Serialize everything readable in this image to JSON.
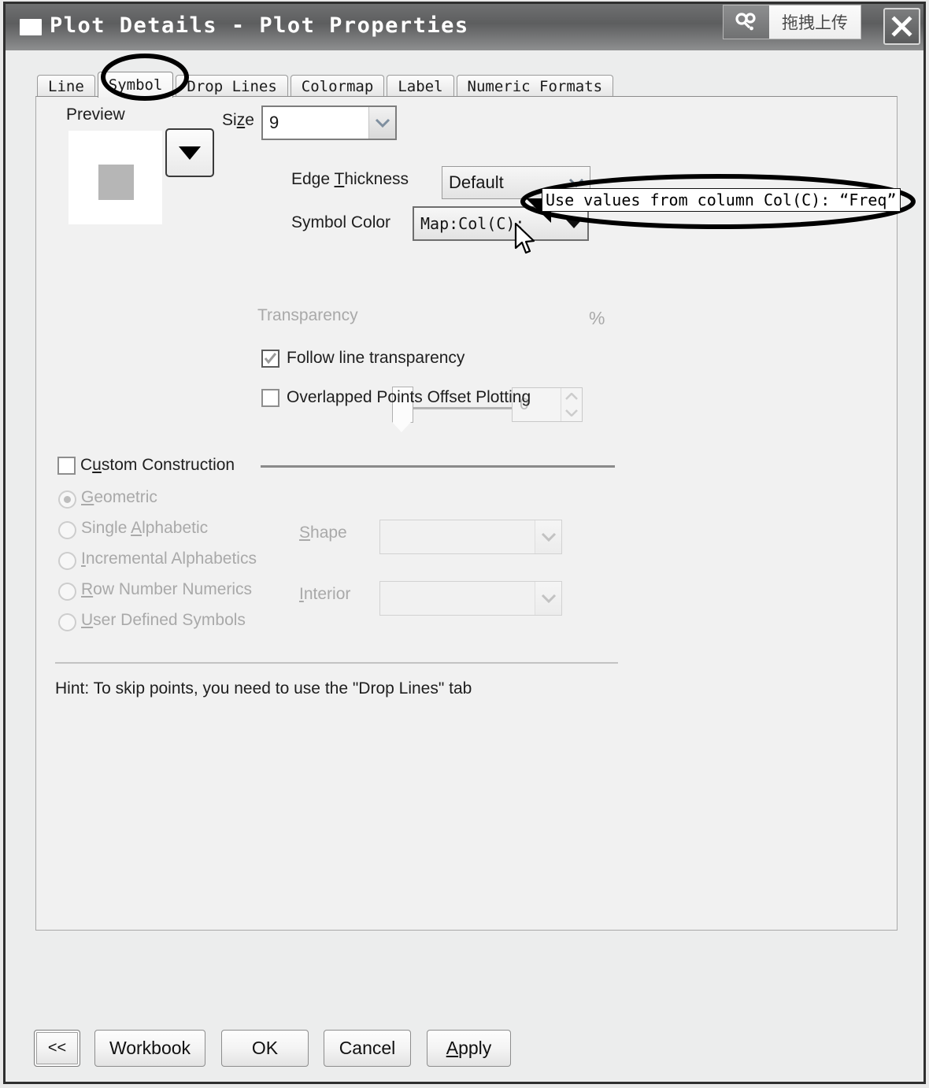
{
  "window": {
    "title": "Plot Details - Plot Properties",
    "icon": "window-square-icon",
    "close_label": "✕"
  },
  "upload_widget": {
    "label": "拖拽上传",
    "icon": "link-chain-icon"
  },
  "tabs": [
    {
      "label": "Line",
      "selected": false
    },
    {
      "label": "Symbol",
      "selected": true
    },
    {
      "label": "Drop Lines",
      "selected": false
    },
    {
      "label": "Colormap",
      "selected": false
    },
    {
      "label": "Label",
      "selected": false
    },
    {
      "label": "Numeric Formats",
      "selected": false
    }
  ],
  "symbol_tab": {
    "preview_label": "Preview",
    "size_label_pre": "Si",
    "size_label_acc": "z",
    "size_label_post": "e",
    "size_value": "9",
    "edge_thickness_label_pre": "Edge ",
    "edge_thickness_acc": "T",
    "edge_thickness_post": "hickness",
    "edge_thickness_value": "Default",
    "symbol_color_label": "Symbol Color",
    "symbol_color_value": "Map:Col(C):",
    "transparency_label": "Transparency",
    "transparency_value": "0",
    "transparency_unit": "%",
    "follow_line_transparency_label": "Follow line transparency",
    "follow_line_transparency_checked": true,
    "overlapped_points_label": "Overlapped Points Offset Plotting",
    "overlapped_points_checked": false,
    "custom_construction_pre": "C",
    "custom_construction_acc": "u",
    "custom_construction_post": "stom Construction",
    "custom_construction_checked": false,
    "construction_options": [
      {
        "pre": "",
        "acc": "G",
        "post": "eometric",
        "selected": true
      },
      {
        "pre": "Single ",
        "acc": "A",
        "post": "lphabetic",
        "selected": false
      },
      {
        "pre": "",
        "acc": "I",
        "post": "ncremental Alphabetics",
        "selected": false
      },
      {
        "pre": "",
        "acc": "R",
        "post": "ow Number Numerics",
        "selected": false
      },
      {
        "pre": "",
        "acc": "U",
        "post": "ser Defined Symbols",
        "selected": false
      }
    ],
    "shape_acc": "S",
    "shape_post": "hape",
    "shape_value": "",
    "interior_acc": "I",
    "interior_post": "nterior",
    "interior_value": "",
    "hint": "Hint: To skip points, you need to use the \"Drop Lines\" tab"
  },
  "annotation": {
    "callout_text": "Use values from column Col(C): “Freq”",
    "circled_tab": "Symbol"
  },
  "footer": {
    "collapse_label": "<<",
    "workbook_label": "Workbook",
    "ok_label": "OK",
    "cancel_label": "Cancel",
    "apply_pre": "",
    "apply_acc": "A",
    "apply_post": "pply"
  },
  "colors": {
    "titlebar": "#5d5e5f",
    "panel_bg": "#f1f1f1",
    "window_bg": "#eceded",
    "symbol_preview": "#b6b6b6",
    "annotation": "#000000"
  }
}
